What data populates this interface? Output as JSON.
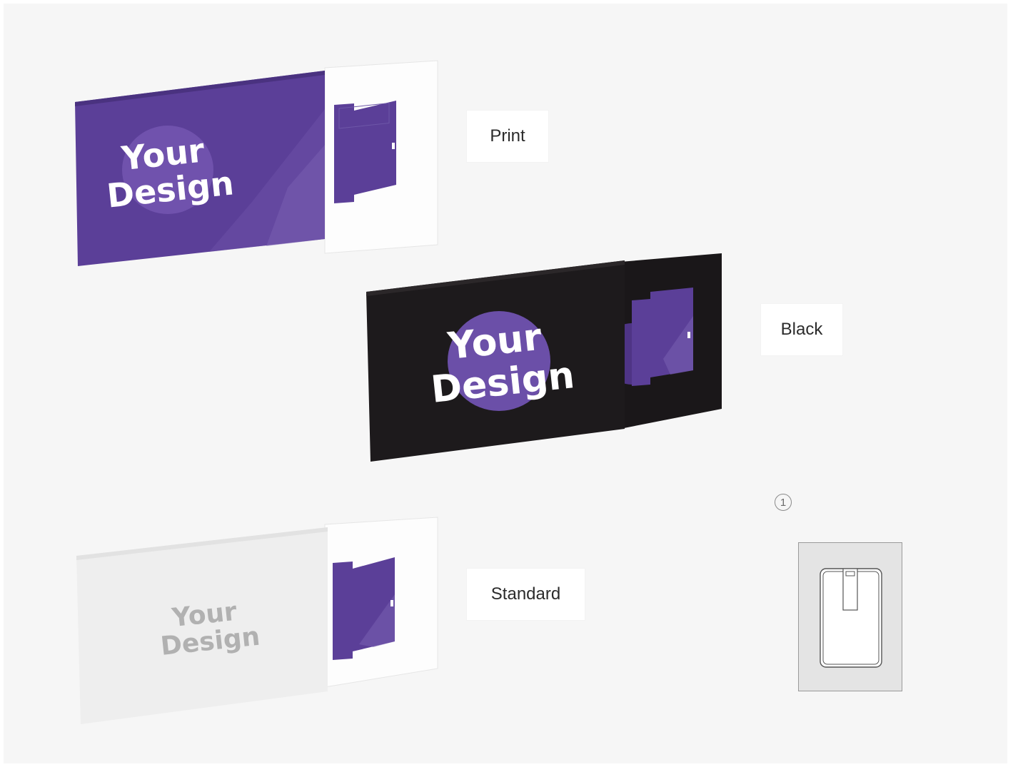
{
  "variants": [
    {
      "id": "print",
      "label": "Print",
      "sleeve_color": "#5b3f98",
      "logo_text_line1": "Your",
      "logo_text_line2": "Design"
    },
    {
      "id": "black",
      "label": "Black",
      "sleeve_color": "#1d1a1c",
      "logo_text_line1": "Your",
      "logo_text_line2": "Design"
    },
    {
      "id": "standard",
      "label": "Standard",
      "sleeve_color": "#eeeeee",
      "logo_text_line1": "Your",
      "logo_text_line2": "Design"
    }
  ],
  "dieline": {
    "step_number": "1",
    "icon": "card-sleeve-outline-icon"
  },
  "colors": {
    "purple": "#5b3f98",
    "purple_light": "#6d52a8",
    "background": "#f6f6f6",
    "black": "#1d1a1c"
  }
}
